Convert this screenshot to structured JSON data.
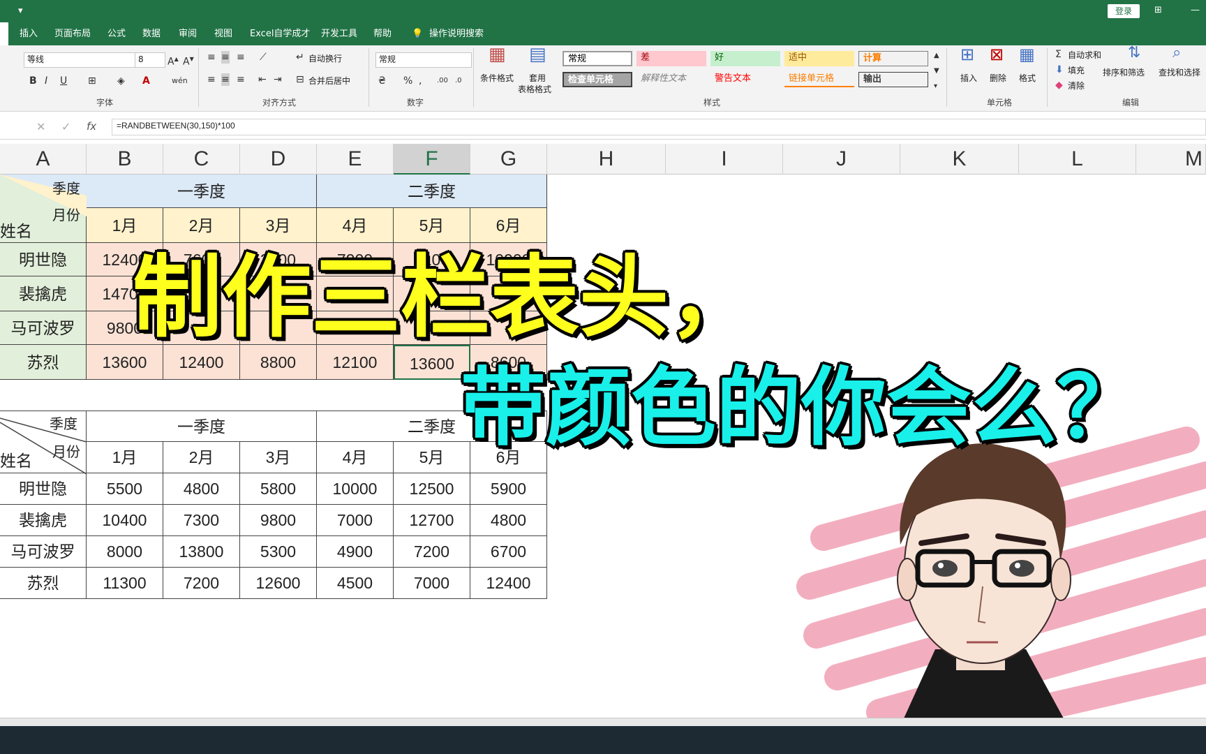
{
  "titlebar": {
    "login_label": "登录"
  },
  "tabs": [
    "插入",
    "页面布局",
    "公式",
    "数据",
    "审阅",
    "视图",
    "Excel自学成才",
    "开发工具",
    "帮助",
    "操作说明搜索"
  ],
  "ribbon": {
    "font_name": "等线",
    "font_size": "8",
    "wrap_text": "自动换行",
    "merge_center": "合并后居中",
    "number_format": "常规",
    "conditional_format": "条件格式",
    "table_format_1": "套用",
    "table_format_2": "表格格式",
    "insert": "插入",
    "delete": "删除",
    "format": "格式",
    "autosum": "自动求和",
    "fill": "填充",
    "clear": "清除",
    "sort_filter": "排序和筛选",
    "find_select": "查找和选择",
    "groups": {
      "font": "字体",
      "align": "对齐方式",
      "number": "数字",
      "styles": "样式",
      "cells": "单元格",
      "edit": "编辑"
    },
    "styles": {
      "normal": "常规",
      "bad": "差",
      "good": "好",
      "neutral": "适中",
      "calc": "计算",
      "check": "检查单元格",
      "explain": "解释性文本",
      "warn": "警告文本",
      "link": "链接单元格",
      "output": "输出"
    }
  },
  "formula": "=RANDBETWEEN(30,150)*100",
  "columns": [
    "A",
    "B",
    "C",
    "D",
    "E",
    "F",
    "G",
    "H",
    "I",
    "J",
    "K",
    "L",
    "M"
  ],
  "table1": {
    "corner_season": "季度",
    "corner_month": "月份",
    "corner_name": "姓名",
    "q1": "一季度",
    "q2": "二季度",
    "months": [
      "1月",
      "2月",
      "3月",
      "4月",
      "5月",
      "6月"
    ],
    "rows": [
      {
        "name": "明世隐",
        "values": [
          "12400",
          "7600",
          "3800",
          "7900",
          "8100",
          "10900"
        ]
      },
      {
        "name": "裴擒虎",
        "values": [
          "14700",
          "",
          "",
          "",
          "",
          ""
        ]
      },
      {
        "name": "马可波罗",
        "values": [
          "9800",
          "",
          "",
          "",
          "",
          ""
        ]
      },
      {
        "name": "苏烈",
        "values": [
          "13600",
          "12400",
          "8800",
          "12100",
          "13600",
          "8600"
        ]
      }
    ]
  },
  "table2": {
    "corner_season": "季度",
    "corner_month": "月份",
    "corner_name": "姓名",
    "q1": "一季度",
    "q2": "二季度",
    "months": [
      "1月",
      "2月",
      "3月",
      "4月",
      "5月",
      "6月"
    ],
    "rows": [
      {
        "name": "明世隐",
        "values": [
          "5500",
          "4800",
          "5800",
          "10000",
          "12500",
          "5900"
        ]
      },
      {
        "name": "裴擒虎",
        "values": [
          "10400",
          "7300",
          "9800",
          "7000",
          "12700",
          "4800"
        ]
      },
      {
        "name": "马可波罗",
        "values": [
          "8000",
          "13800",
          "5300",
          "4900",
          "7200",
          "6700"
        ]
      },
      {
        "name": "苏烈",
        "values": [
          "11300",
          "7200",
          "12600",
          "4500",
          "7000",
          "12400"
        ]
      }
    ]
  },
  "overlay": {
    "line1": "制作三栏表头，",
    "line2": "带颜色的你会么？"
  },
  "colors": {
    "excel_green": "#217346",
    "title_yellow": "#ffff1e",
    "title_cyan": "#19f0ea",
    "pink": "#f0a0b4"
  }
}
